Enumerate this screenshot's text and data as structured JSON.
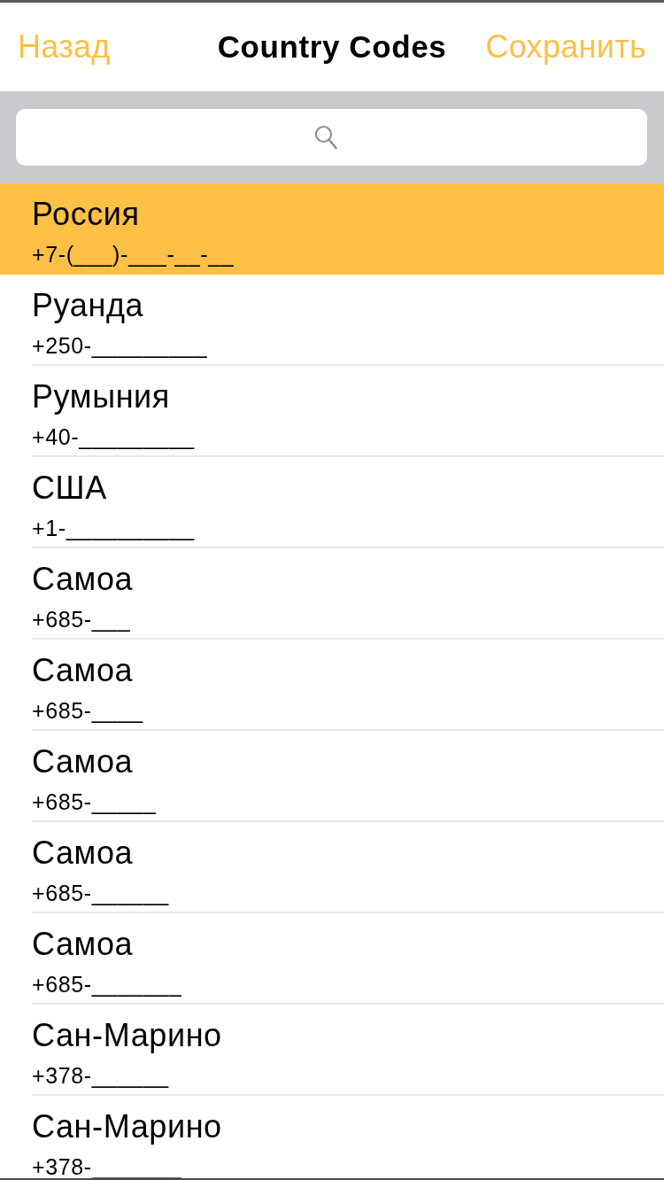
{
  "nav": {
    "back": "Назад",
    "title": "Country Codes",
    "save": "Сохранить"
  },
  "countries": [
    {
      "name": "Россия",
      "mask": "+7-(___)-___-__-__",
      "selected": true
    },
    {
      "name": "Руанда",
      "mask": "+250-_________",
      "selected": false
    },
    {
      "name": "Румыния",
      "mask": "+40-_________",
      "selected": false
    },
    {
      "name": "США",
      "mask": "+1-__________",
      "selected": false
    },
    {
      "name": "Самоа",
      "mask": "+685-___",
      "selected": false
    },
    {
      "name": "Самоа",
      "mask": "+685-____",
      "selected": false
    },
    {
      "name": "Самоа",
      "mask": "+685-_____",
      "selected": false
    },
    {
      "name": "Самоа",
      "mask": "+685-______",
      "selected": false
    },
    {
      "name": "Самоа",
      "mask": "+685-_______",
      "selected": false
    },
    {
      "name": "Сан-Марино",
      "mask": "+378-______",
      "selected": false
    },
    {
      "name": "Сан-Марино",
      "mask": "+378-_______",
      "selected": false
    }
  ]
}
